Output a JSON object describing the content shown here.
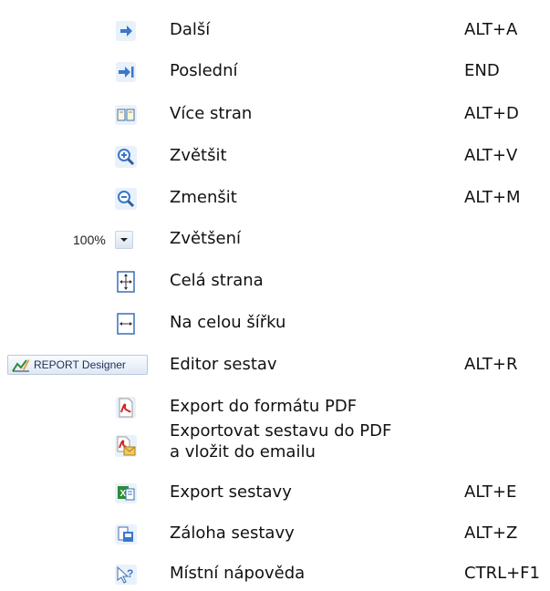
{
  "items": [
    {
      "label": "Další",
      "shortcut": "ALT+A",
      "icon": "arrow-next-icon"
    },
    {
      "label": "Poslední",
      "shortcut": "END",
      "icon": "arrow-last-icon"
    },
    {
      "label": "Více stran",
      "shortcut": "ALT+D",
      "icon": "multiple-pages-icon"
    },
    {
      "label": "Zvětšit",
      "shortcut": "ALT+V",
      "icon": "zoom-in-icon"
    },
    {
      "label": "Zmenšit",
      "shortcut": "ALT+M",
      "icon": "zoom-out-icon"
    },
    {
      "label": "Zvětšení",
      "shortcut": "",
      "icon": "zoom-dropdown",
      "control_value": "100%"
    },
    {
      "label": "Celá strana",
      "shortcut": "",
      "icon": "whole-page-icon"
    },
    {
      "label": "Na celou šířku",
      "shortcut": "",
      "icon": "page-width-icon"
    },
    {
      "label": "Editor sestav",
      "shortcut": "ALT+R",
      "icon": "report-designer-button",
      "control_prefix": "REPORT Designer"
    },
    {
      "label": "Export do formátu PDF",
      "shortcut": "",
      "icon": "pdf-icon"
    },
    {
      "label_line1": "Exportovat sestavu do PDF",
      "label_line2": "a vložit do emailu",
      "shortcut": "",
      "icon": "pdf-email-icon"
    },
    {
      "label": "Export sestavy",
      "shortcut": "ALT+E",
      "icon": "excel-export-icon"
    },
    {
      "label": "Záloha sestavy",
      "shortcut": "ALT+Z",
      "icon": "report-backup-icon"
    },
    {
      "label": "Místní nápověda",
      "shortcut": "CTRL+F1",
      "icon": "context-help-icon"
    }
  ],
  "colors": {
    "icon_blue": "#3a78c9",
    "pdf_red": "#d32626",
    "excel_green": "#2e8b3a"
  }
}
